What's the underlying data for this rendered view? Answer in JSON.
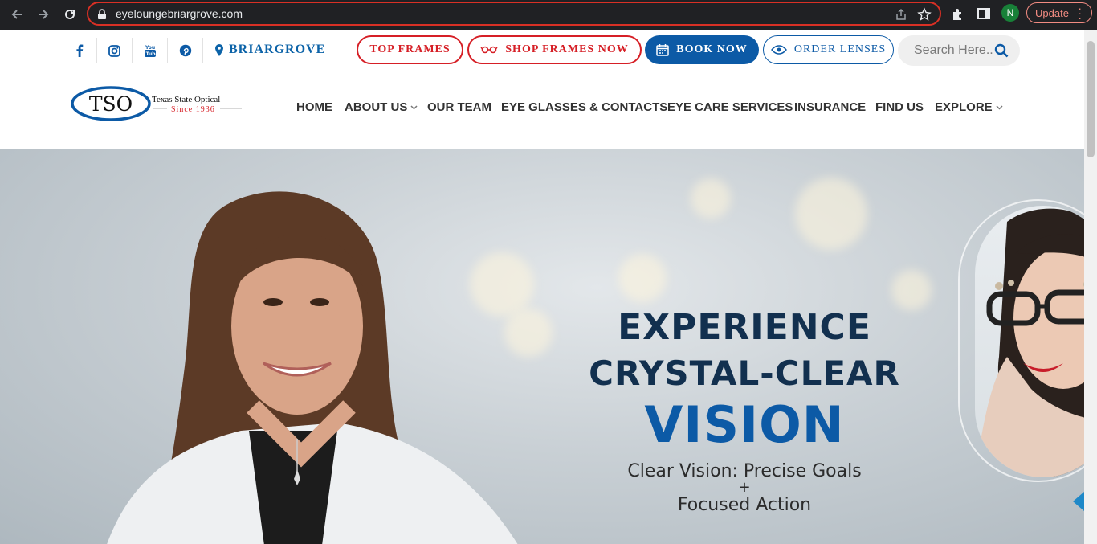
{
  "browser": {
    "url": "eyeloungebriargrove.com",
    "profile_initial": "N",
    "update_label": "Update"
  },
  "topbar": {
    "location": "BRIARGROVE",
    "buttons": {
      "top_frames": "TOP FRAMES",
      "shop_frames": "SHOP FRAMES NOW",
      "book_now": "BOOK NOW",
      "order_lenses": "ORDER LENSES"
    },
    "search_placeholder": "Search Here.."
  },
  "logo": {
    "mark": "TSO",
    "name": "Texas State Optical",
    "since": "Since 1936"
  },
  "menu": [
    {
      "label": "HOME"
    },
    {
      "label": "ABOUT US"
    },
    {
      "label": "OUR TEAM"
    },
    {
      "label": "EYE GLASSES & CONTACTS"
    },
    {
      "label": "EYE CARE SERVICES"
    },
    {
      "label": "INSURANCE"
    },
    {
      "label": "FIND US"
    },
    {
      "label": "EXPLORE"
    }
  ],
  "hero": {
    "line1": "EXPERIENCE",
    "line2": "CRYSTAL-CLEAR",
    "line3": "VISION",
    "sub1": "Clear Vision: Precise Goals",
    "plus": "+",
    "sub2": "Focused Action"
  },
  "colors": {
    "brand_blue": "#0c5aa6",
    "brand_red": "#d61f26",
    "nav_text": "#333333"
  }
}
